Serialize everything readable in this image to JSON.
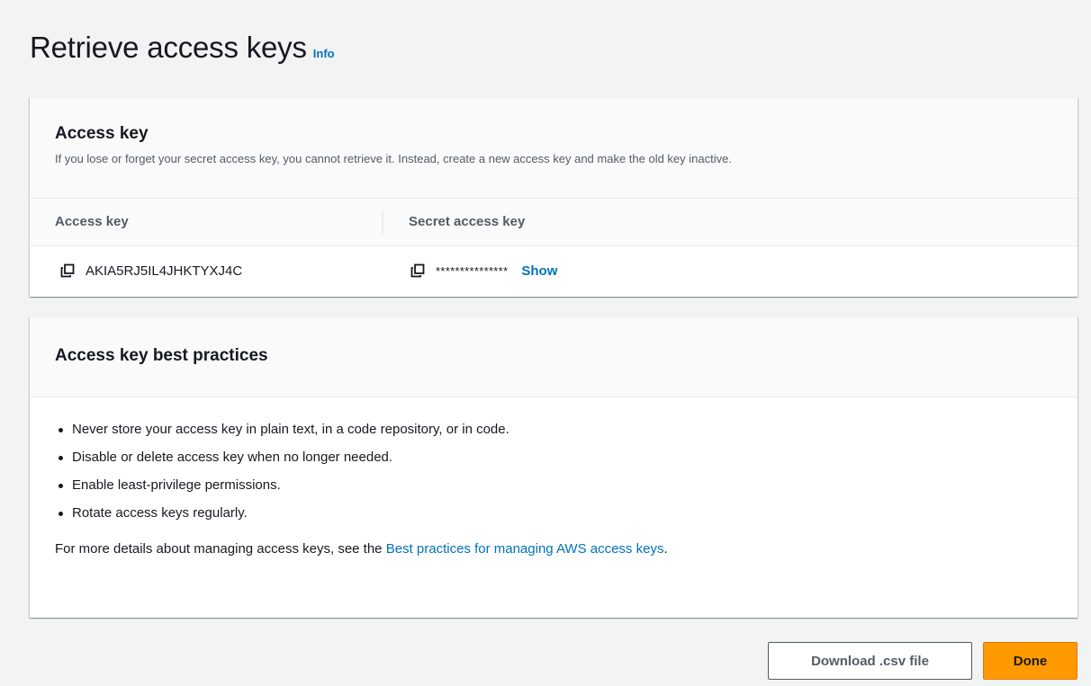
{
  "header": {
    "title": "Retrieve access keys",
    "info_label": "Info"
  },
  "access_key_panel": {
    "heading": "Access key",
    "description": "If you lose or forget your secret access key, you cannot retrieve it. Instead, create a new access key and make the old key inactive.",
    "columns": [
      "Access key",
      "Secret access key"
    ],
    "access_key_value": "AKIA5RJ5IL4JHKTYXJ4C",
    "secret_key_masked": "***************",
    "show_label": "Show"
  },
  "best_practices_panel": {
    "heading": "Access key best practices",
    "items": [
      "Never store your access key in plain text, in a code repository, or in code.",
      "Disable or delete access key when no longer needed.",
      "Enable least-privilege permissions.",
      "Rotate access keys regularly."
    ],
    "more_prefix": "For more details about managing access keys, see the ",
    "more_link": "Best practices for managing AWS access keys",
    "more_suffix": "."
  },
  "actions": {
    "download_label": "Download .csv file",
    "done_label": "Done"
  },
  "icons": {
    "copy": "copy-icon"
  },
  "colors": {
    "link": "#0073bb",
    "primary": "#ff9900",
    "background": "#f2f3f3"
  }
}
